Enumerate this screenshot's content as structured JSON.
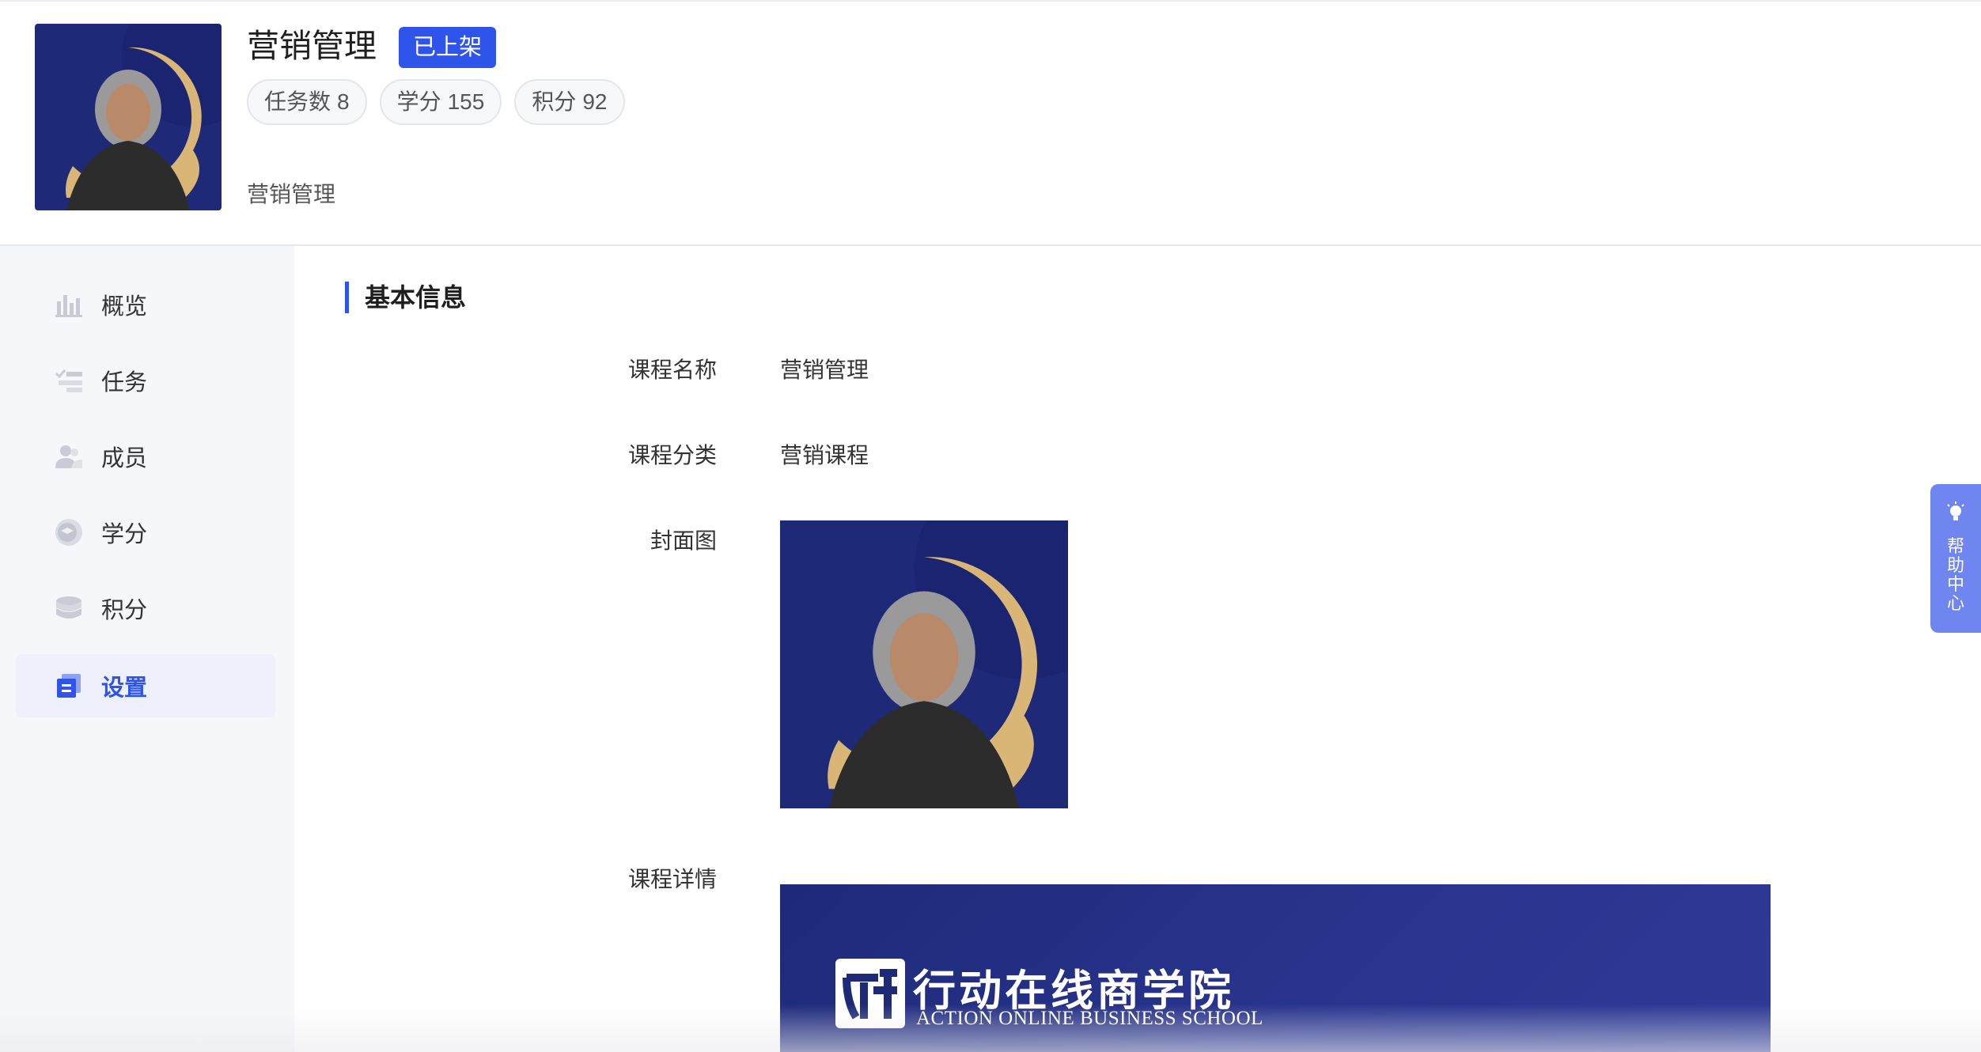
{
  "header": {
    "title": "营销管理",
    "status_badge": "已上架",
    "stats": [
      {
        "label": "任务数",
        "value": "8"
      },
      {
        "label": "学分",
        "value": "155"
      },
      {
        "label": "积分",
        "value": "92"
      }
    ],
    "subtitle": "营销管理"
  },
  "sidebar": {
    "items": [
      {
        "label": "概览",
        "icon": "bar-chart-icon"
      },
      {
        "label": "任务",
        "icon": "task-list-icon"
      },
      {
        "label": "成员",
        "icon": "members-icon"
      },
      {
        "label": "学分",
        "icon": "credit-icon"
      },
      {
        "label": "积分",
        "icon": "points-icon"
      },
      {
        "label": "设置",
        "icon": "settings-icon",
        "active": true
      }
    ]
  },
  "section": {
    "title": "基本信息",
    "fields": {
      "name_label": "课程名称",
      "name_value": "营销管理",
      "category_label": "课程分类",
      "category_value": "营销课程",
      "cover_label": "封面图",
      "detail_label": "课程详情"
    }
  },
  "detail_banner": {
    "logo_cn": "行动在线商学院",
    "logo_en": "ACTION ONLINE BUSINESS SCHOOL"
  },
  "help": {
    "label": "帮助中心"
  },
  "colors": {
    "accent": "#2f54eb",
    "cover_bg": "#1e2a78",
    "gold": "#d9b676",
    "help": "#6f86f0"
  }
}
